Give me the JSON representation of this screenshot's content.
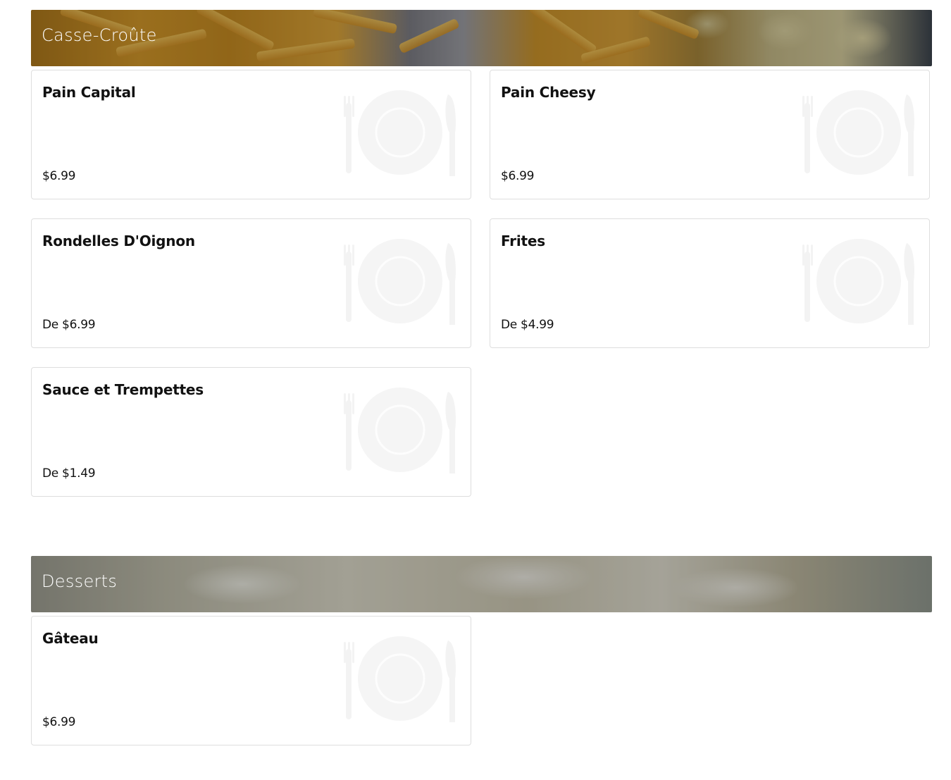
{
  "sections": [
    {
      "title": "Casse-Croûte",
      "items": [
        {
          "name": "Pain Capital",
          "price": "$6.99"
        },
        {
          "name": "Pain Cheesy",
          "price": "$6.99"
        },
        {
          "name": "Rondelles D'Oignon",
          "price": "De $6.99"
        },
        {
          "name": "Frites",
          "price": "De $4.99"
        },
        {
          "name": "Sauce et Trempettes",
          "price": "De $1.49"
        }
      ]
    },
    {
      "title": "Desserts",
      "items": [
        {
          "name": "Gâteau",
          "price": "$6.99"
        }
      ]
    }
  ],
  "placeholder_icon": "plate-fork-knife-icon",
  "colors": {
    "card_border": "#dedede",
    "header_text": "#ffffff",
    "text": "#111111"
  }
}
